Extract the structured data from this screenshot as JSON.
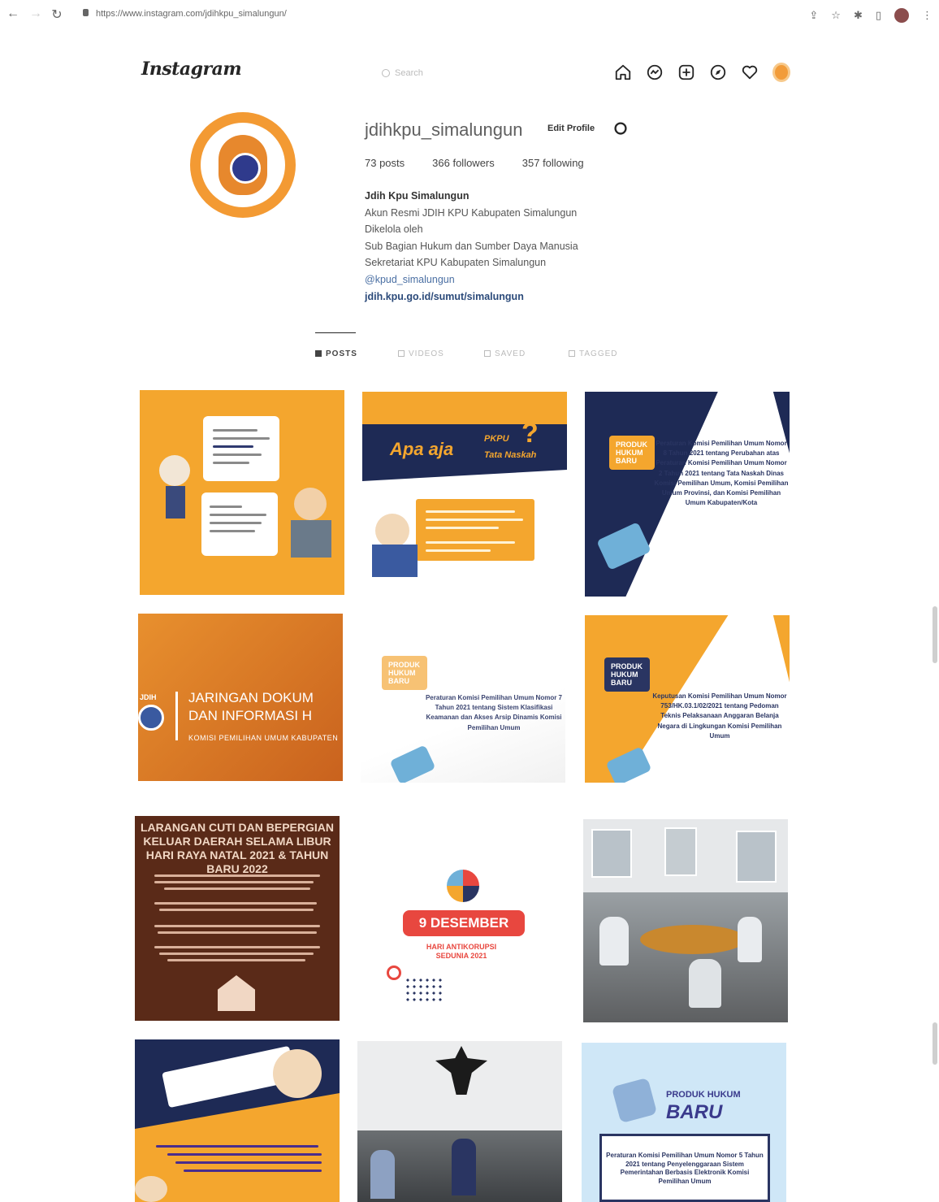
{
  "browser": {
    "url": "https://www.instagram.com/jdihkpu_simalungun/"
  },
  "header": {
    "logo": "Instagram",
    "search_placeholder": "Search"
  },
  "profile": {
    "username": "jdihkpu_simalungun",
    "edit_label": "Edit Profile",
    "posts": "73 posts",
    "followers": "366 followers",
    "following": "357 following",
    "bio": {
      "name": "Jdih Kpu Simalungun",
      "line1": "Akun Resmi JDIH KPU Kabupaten Simalungun",
      "line2": "Dikelola oleh",
      "line3": "Sub Bagian Hukum dan Sumber Daya Manusia",
      "line4": "Sekretariat KPU Kabupaten Simalungun",
      "handle": "@kpud_simalungun",
      "link": "jdih.kpu.go.id/sumut/simalungun"
    }
  },
  "tabs": [
    {
      "label": "POSTS",
      "active": true
    },
    {
      "label": "VIDEOS",
      "active": false
    },
    {
      "label": "SAVED",
      "active": false
    },
    {
      "label": "TAGGED",
      "active": false
    }
  ],
  "posts": {
    "p2": {
      "title1": "Apa aja",
      "title2": "PKPU",
      "title3": "Tata Naskah"
    },
    "p3": {
      "badge": "PRODUK HUKUM BARU",
      "text": "Peraturan Komisi Pemilihan Umum Nomor 8 Tahun 2021 tentang Perubahan atas Peraturan Komisi Pemilihan Umum Nomor 2 Tahun 2021 tentang Tata Naskah Dinas Komisi Pemilihan Umum, Komisi Pemilihan Umum Provinsi, dan Komisi Pemilihan Umum Kabupaten/Kota"
    },
    "p4": {
      "line1": "JARINGAN DOKUM",
      "line2": "DAN INFORMASI H",
      "line3": "KOMISI PEMILIHAN UMUM KABUPATEN",
      "logo": "JDIH"
    },
    "p5": {
      "badge": "PRODUK HUKUM BARU",
      "text": "Peraturan Komisi Pemilihan Umum Nomor 7 Tahun 2021 tentang Sistem Klasifikasi Keamanan dan Akses Arsip Dinamis Komisi Pemilihan Umum"
    },
    "p6": {
      "badge": "PRODUK HUKUM BARU",
      "text": "Keputusan Komisi Pemilihan Umum Nomor 753/HK.03.1/02/2021 tentang Pedoman Teknis Pelaksanaan Anggaran Belanja Negara di Lingkungan Komisi Pemilihan Umum"
    },
    "p7": {
      "line1": "LARANGAN CUTI DAN BEPERGIAN",
      "line2": "KELUAR DAERAH SELAMA LIBUR",
      "line3": "HARI RAYA NATAL 2021 & TAHUN BARU 2022"
    },
    "p8": {
      "date": "9 DESEMBER",
      "sub1": "HARI ANTIKORUPSI",
      "sub2": "SEDUNIA 2021"
    },
    "p11": {
      "title1": "PRODUK HUKUM",
      "title2": "BARU",
      "text": "Peraturan Komisi Pemilihan Umum Nomor 5 Tahun 2021 tentang Penyelenggaraan Sistem Pemerintahan Berbasis Elektronik Komisi Pemilihan Umum"
    }
  },
  "colors": {
    "accent_orange": "#f4a62e",
    "navy": "#1e2a55",
    "brown": "#5a2a18",
    "red": "#e8473f"
  }
}
